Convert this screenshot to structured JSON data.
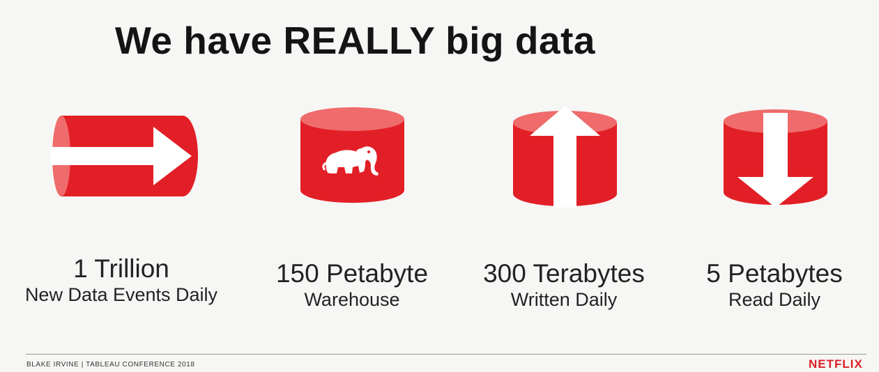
{
  "slide": {
    "title": "We have REALLY big data"
  },
  "stats": [
    {
      "value": "1 Trillion",
      "label": "New Data Events Daily",
      "icon": "horizontal-pipe-arrow-icon"
    },
    {
      "value": "150 Petabyte",
      "label": "Warehouse",
      "icon": "elephant-cylinder-icon"
    },
    {
      "value": "300 Terabytes",
      "label": "Written Daily",
      "icon": "cylinder-up-arrow-icon"
    },
    {
      "value": "5 Petabytes",
      "label": "Read Daily",
      "icon": "cylinder-down-arrow-icon"
    }
  ],
  "footer": {
    "presenter": "BLAKE IRVINE | TABLEAU CONFERENCE 2018",
    "brand": "NETFLIX"
  },
  "colors": {
    "accent": "#e21f26",
    "accent_light": "#ef6b6c",
    "background": "#f6f6f4"
  }
}
